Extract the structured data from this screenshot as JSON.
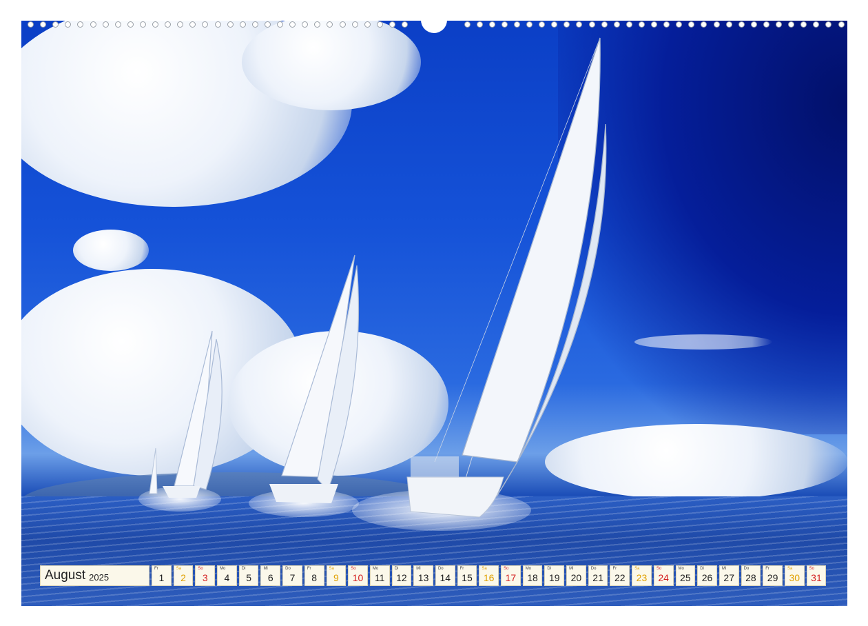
{
  "calendar": {
    "month": "August",
    "year": "2025",
    "days": [
      {
        "wd": "Fr",
        "num": "1",
        "kind": "week"
      },
      {
        "wd": "Sa",
        "num": "2",
        "kind": "sat"
      },
      {
        "wd": "So",
        "num": "3",
        "kind": "sun"
      },
      {
        "wd": "Mo",
        "num": "4",
        "kind": "week"
      },
      {
        "wd": "Di",
        "num": "5",
        "kind": "week"
      },
      {
        "wd": "Mi",
        "num": "6",
        "kind": "week"
      },
      {
        "wd": "Do",
        "num": "7",
        "kind": "week"
      },
      {
        "wd": "Fr",
        "num": "8",
        "kind": "week"
      },
      {
        "wd": "Sa",
        "num": "9",
        "kind": "sat"
      },
      {
        "wd": "So",
        "num": "10",
        "kind": "sun"
      },
      {
        "wd": "Mo",
        "num": "11",
        "kind": "week"
      },
      {
        "wd": "Di",
        "num": "12",
        "kind": "week"
      },
      {
        "wd": "Mi",
        "num": "13",
        "kind": "week"
      },
      {
        "wd": "Do",
        "num": "14",
        "kind": "week"
      },
      {
        "wd": "Fr",
        "num": "15",
        "kind": "week"
      },
      {
        "wd": "Sa",
        "num": "16",
        "kind": "sat"
      },
      {
        "wd": "So",
        "num": "17",
        "kind": "sun"
      },
      {
        "wd": "Mo",
        "num": "18",
        "kind": "week"
      },
      {
        "wd": "Di",
        "num": "19",
        "kind": "week"
      },
      {
        "wd": "Mi",
        "num": "20",
        "kind": "week"
      },
      {
        "wd": "Do",
        "num": "21",
        "kind": "week"
      },
      {
        "wd": "Fr",
        "num": "22",
        "kind": "week"
      },
      {
        "wd": "Sa",
        "num": "23",
        "kind": "sat"
      },
      {
        "wd": "So",
        "num": "24",
        "kind": "sun"
      },
      {
        "wd": "Mo",
        "num": "25",
        "kind": "week"
      },
      {
        "wd": "Di",
        "num": "26",
        "kind": "week"
      },
      {
        "wd": "Mi",
        "num": "27",
        "kind": "week"
      },
      {
        "wd": "Do",
        "num": "28",
        "kind": "week"
      },
      {
        "wd": "Fr",
        "num": "29",
        "kind": "week"
      },
      {
        "wd": "Sa",
        "num": "30",
        "kind": "sat"
      },
      {
        "wd": "So",
        "num": "31",
        "kind": "sun"
      }
    ]
  },
  "colors": {
    "weekday": "#222222",
    "saturday": "#e0a000",
    "sunday": "#d42020",
    "cell_bg": "#fbf8ea"
  },
  "image": {
    "subject_icons": [
      "sailboat-icon",
      "cloud-icon"
    ]
  }
}
